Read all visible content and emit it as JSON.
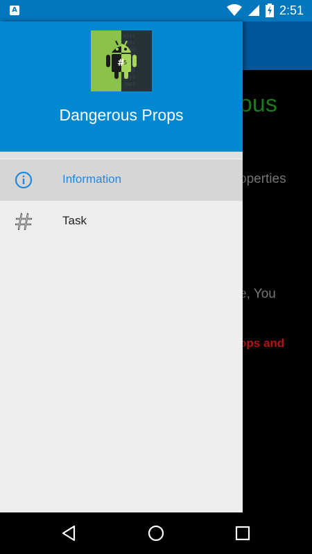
{
  "status_bar": {
    "time": "2:51",
    "left_icon": "A",
    "icons": [
      "wifi-icon",
      "signal-icon",
      "battery-charging-icon"
    ]
  },
  "background": {
    "title_fragment": "ous",
    "text1_fragment": "operties",
    "text2_fragment": "e, You",
    "text3_fragment": "ops and"
  },
  "drawer": {
    "header": {
      "title": "Dangerous Props",
      "logo": "android-hash-logo"
    },
    "items": [
      {
        "label": "Information",
        "icon": "info-icon",
        "selected": true
      },
      {
        "label": "Task",
        "icon": "hash-icon",
        "selected": false
      }
    ]
  },
  "colors": {
    "header": "#0288d1",
    "status_bar": "#0277bd",
    "selected_text": "#1e88e5"
  },
  "nav_bar": {
    "buttons": [
      "back-icon",
      "home-icon",
      "recents-icon"
    ]
  }
}
